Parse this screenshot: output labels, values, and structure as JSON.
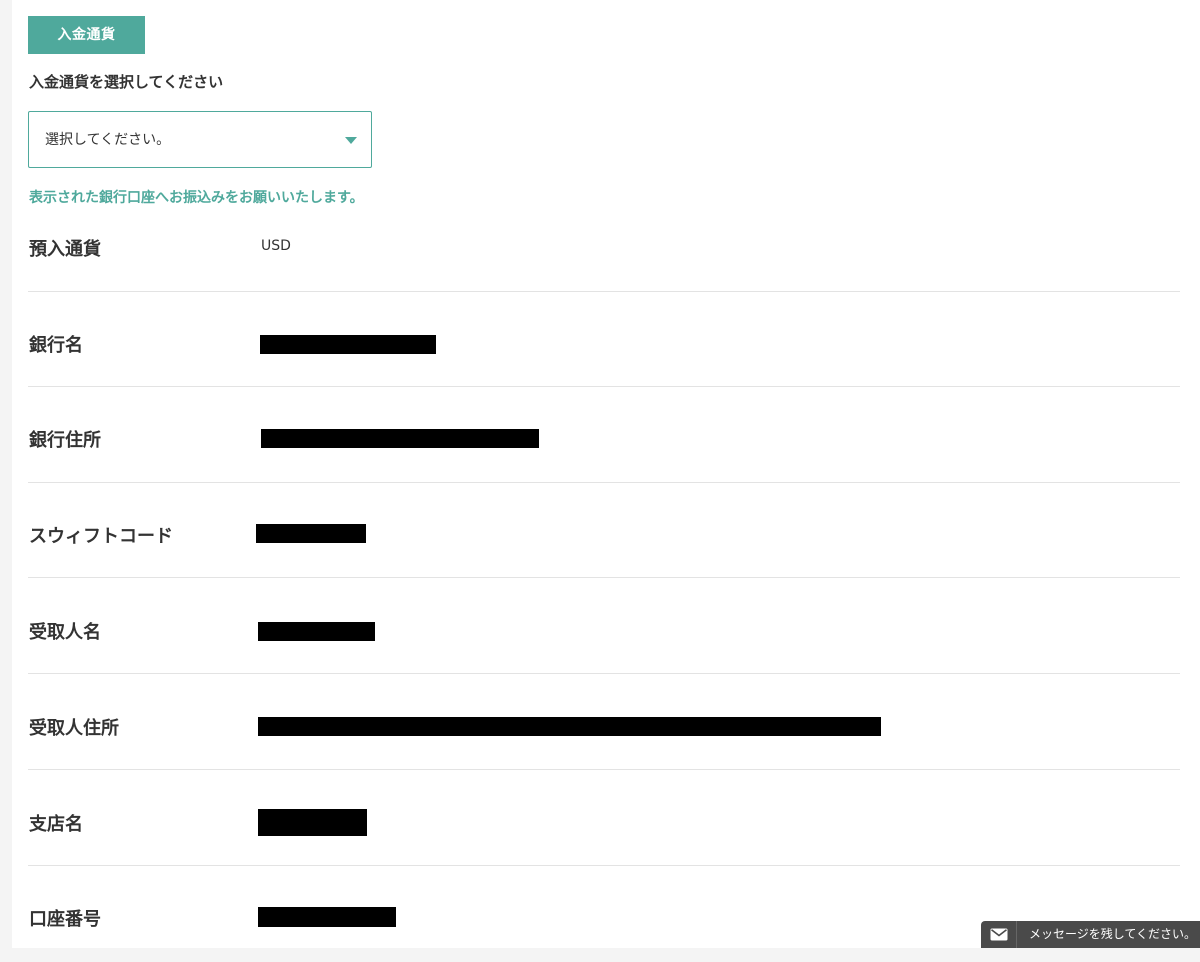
{
  "deposit": {
    "section_tag": "入金通貨",
    "prompt_label": "入金通貨を選択してください",
    "select": {
      "selected_value": "選択してください。"
    },
    "instruction": "表示された銀行口座へお振込みをお願いいたします。"
  },
  "bank_details": {
    "rows": [
      {
        "label": "預入通貨",
        "value": "USD"
      },
      {
        "label": "銀行名",
        "value": null,
        "redacted": true
      },
      {
        "label": "銀行住所",
        "value": null,
        "redacted": true
      },
      {
        "label": "スウィフトコード",
        "value": null,
        "redacted": true
      },
      {
        "label": "受取人名",
        "value": null,
        "redacted": true
      },
      {
        "label": "受取人住所",
        "value": null,
        "redacted": true
      },
      {
        "label": "支店名",
        "value": null,
        "redacted": true
      },
      {
        "label": "口座番号",
        "value": null,
        "redacted": true
      }
    ]
  },
  "chat_widget": {
    "icon": "envelope-icon",
    "label": "メッセージを残してください。"
  },
  "colors": {
    "accent": "#4fa99c",
    "redaction": "#000000",
    "chat_bg": "#4a4a4a"
  }
}
